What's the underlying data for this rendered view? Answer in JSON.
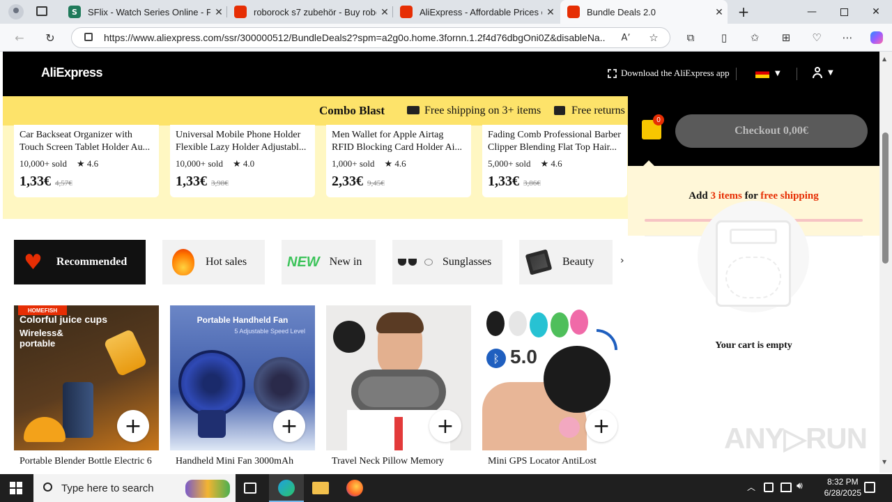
{
  "browser": {
    "tabs": [
      {
        "title": "SFlix - Watch Series Online - FREE"
      },
      {
        "title": "roborock s7 zubehör - Buy roborock"
      },
      {
        "title": "AliExpress - Affordable Prices on T"
      },
      {
        "title": "Bundle Deals 2.0"
      }
    ],
    "url": "https://www.aliexpress.com/ssr/300000512/BundleDeals2?spm=a2g0o.home.3fornn.1.2f4d76dbgOni0Z&disableNa..."
  },
  "header": {
    "logo": "AliExpress",
    "download_app": "Download the AliExpress app"
  },
  "combo": {
    "title": "Combo Blast",
    "free_shipping": "Free shipping on 3+ items",
    "free_returns": "Free returns"
  },
  "top_products": [
    {
      "name": "Car Backseat Organizer with Touch Screen Tablet Holder Au...",
      "sold": "10,000+ sold",
      "rating": "4.6",
      "price": "1,33€",
      "old_price": "4,57€"
    },
    {
      "name": "Universal Mobile Phone Holder Flexible Lazy Holder Adjustabl...",
      "sold": "10,000+ sold",
      "rating": "4.0",
      "price": "1,33€",
      "old_price": "3,98€"
    },
    {
      "name": "Men Wallet for Apple Airtag RFID Blocking Card Holder Ai...",
      "sold": "1,000+ sold",
      "rating": "4.6",
      "price": "2,33€",
      "old_price": "9,45€"
    },
    {
      "name": "Fading Comb Professional Barber Clipper Blending Flat Top Hair...",
      "sold": "5,000+ sold",
      "rating": "4.6",
      "price": "1,33€",
      "old_price": "3,86€"
    }
  ],
  "categories": [
    {
      "label": "Recommended"
    },
    {
      "label": "Hot sales"
    },
    {
      "label": "New in"
    },
    {
      "label": "Sunglasses"
    },
    {
      "label": "Beauty"
    }
  ],
  "products": [
    {
      "name": "Portable Blender Bottle Electric 6",
      "img_title": "Colorful juice cups",
      "img_sub": "Wireless& portable"
    },
    {
      "name": "Handheld Mini Fan 3000mAh",
      "img_title": "Portable Handheld Fan",
      "img_sub": "5 Adjustable Speed Level"
    },
    {
      "name": "Travel Neck Pillow Memory",
      "img_title": "",
      "img_sub": ""
    },
    {
      "name": "Mini GPS Locator AntiLost",
      "img_title": "5.0",
      "img_sub": ""
    }
  ],
  "cart": {
    "count": "0",
    "checkout": "Checkout 0,00€",
    "add_prefix": "Add",
    "add_items": "3 items",
    "add_for": "for",
    "add_free": "free shipping",
    "empty": "Your cart is empty"
  },
  "taskbar": {
    "search_placeholder": "Type here to search",
    "time": "8:32 PM",
    "date": "6/28/2025"
  },
  "colors": {
    "accent_red": "#e62e04",
    "combo_yellow": "#fde36a"
  }
}
